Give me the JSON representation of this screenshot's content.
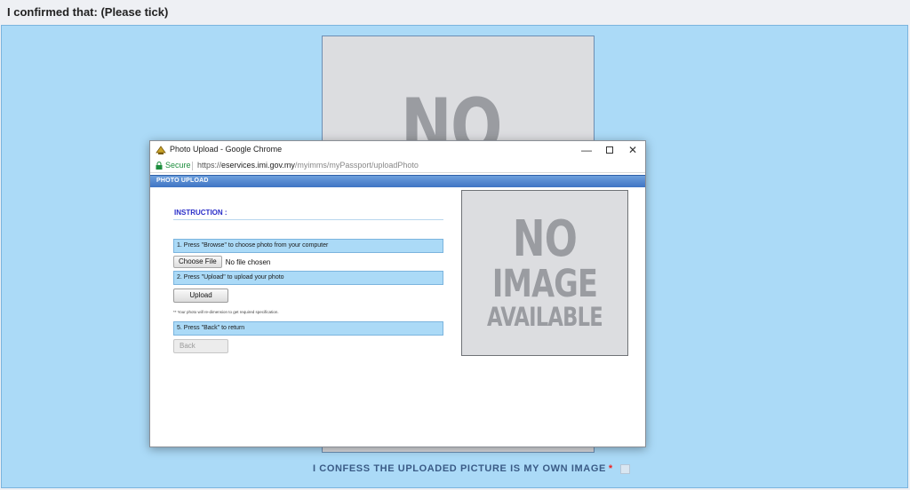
{
  "page": {
    "confirm_text": "I confirmed that: (Please tick)",
    "bg_placeholder_text": "NO",
    "confess_text": "I CONFESS THE UPLOADED PICTURE IS MY OWN IMAGE",
    "required_mark": "*",
    "confess_checked": false
  },
  "window": {
    "title": "Photo Upload - Google Chrome",
    "minimize_glyph": "—",
    "close_glyph": "✕",
    "secure_label": "Secure",
    "url_scheme": "https://",
    "url_host": "eservices.imi.gov.my",
    "url_path": "/myimms/myPassport/uploadPhoto"
  },
  "upload": {
    "header": "PHOTO UPLOAD",
    "instruction_title": "INSTRUCTION :",
    "step1": "1. Press \"Browse\" to choose photo from your computer",
    "choose_file_label": "Choose File",
    "no_file_text": "No file chosen",
    "step2": "2. Press \"Upload\" to upload your photo",
    "upload_label": "Upload",
    "note": "** Your photo will re-dimension to get required specification.",
    "step3": "5. Press \"Back\" to return",
    "back_label": "Back"
  },
  "placeholder": {
    "line1": "NO",
    "line2": "IMAGE",
    "line3": "AVAILABLE"
  },
  "colors": {
    "panel_blue": "#abdaf7",
    "header_blue": "#4a7fcc",
    "instruction_color": "#2b2fc9",
    "secure_green": "#1e8e3e",
    "required_red": "#ee2222"
  },
  "icons": {
    "app": "crest-icon",
    "lock": "lock-icon"
  }
}
